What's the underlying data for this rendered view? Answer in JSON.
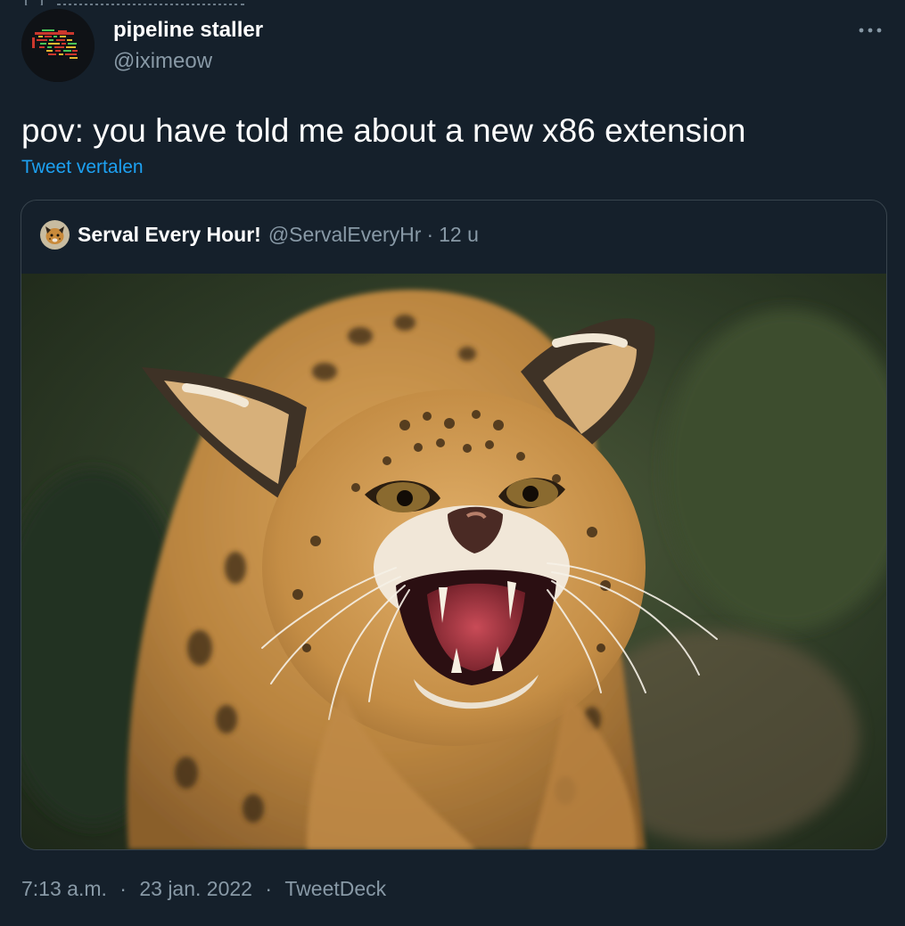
{
  "theme": {
    "background": "#15202b",
    "primary_text": "#ffffff",
    "secondary_text": "#8899a6",
    "link": "#1da1f2",
    "border": "#38444d"
  },
  "tweet": {
    "author": {
      "display_name": "pipeline staller",
      "handle": "@iximeow",
      "avatar_icon": "pixel-art-avatar"
    },
    "more_icon": "more-horizontal-icon",
    "text": "pov: you have told me about a new x86 extension",
    "translate_label": "Tweet vertalen",
    "quote": {
      "author_name": "Serval Every Hour!",
      "author_handle": "@ServalEveryHr",
      "separator": "·",
      "time": "12 u",
      "media_subject": "serval-photo"
    },
    "meta": {
      "time": "7:13 a.m.",
      "separator": "·",
      "date": "23 jan. 2022",
      "source": "TweetDeck"
    }
  }
}
